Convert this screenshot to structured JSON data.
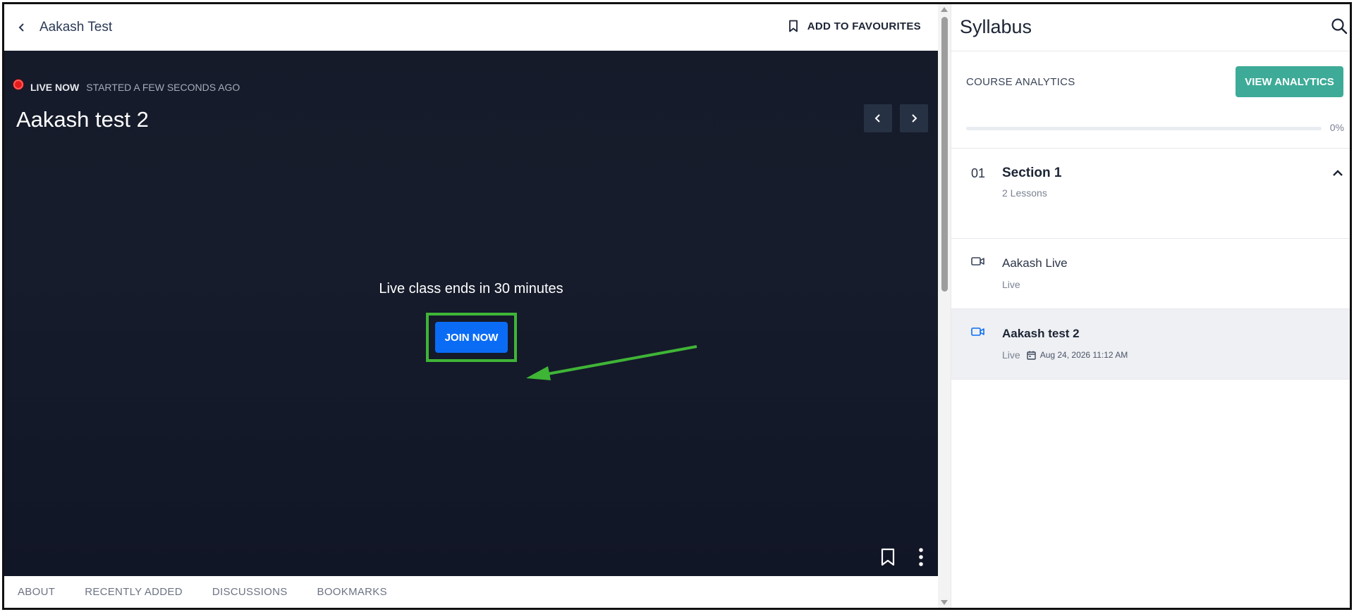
{
  "header": {
    "back_label": "Aakash Test",
    "favourites_label": "ADD TO FAVOURITES"
  },
  "player": {
    "live_label": "LIVE NOW",
    "started_label": "STARTED A FEW SECONDS AGO",
    "title": "Aakash test 2",
    "ends_text": "Live class ends in 30 minutes",
    "join_label": "JOIN NOW"
  },
  "tabs": [
    {
      "label": "ABOUT"
    },
    {
      "label": "RECENTLY ADDED"
    },
    {
      "label": "DISCUSSIONS"
    },
    {
      "label": "BOOKMARKS"
    }
  ],
  "syllabus": {
    "title": "Syllabus",
    "analytics_label": "COURSE ANALYTICS",
    "view_analytics_label": "VIEW ANALYTICS",
    "progress_percent": 0,
    "progress_text": "0%",
    "section": {
      "number": "01",
      "title": "Section 1",
      "lessons_count": "2 Lessons"
    },
    "lessons": [
      {
        "title": "Aakash Live",
        "status": "Live",
        "date": ""
      },
      {
        "title": "Aakash test 2",
        "status": "Live",
        "date": "Aug 24, 2026 11:12 AM"
      }
    ]
  },
  "colors": {
    "accent_blue": "#0a6cf5",
    "teal": "#3dab97",
    "highlight_green": "#3fb536",
    "player_bg": "#151b29",
    "live_red": "#e51b1b"
  },
  "icons": [
    "chevron-left-icon",
    "bookmark-icon",
    "chevron-right-icon",
    "more-vertical-icon",
    "search-icon",
    "chevron-up-icon",
    "video-camera-icon",
    "calendar-icon"
  ]
}
